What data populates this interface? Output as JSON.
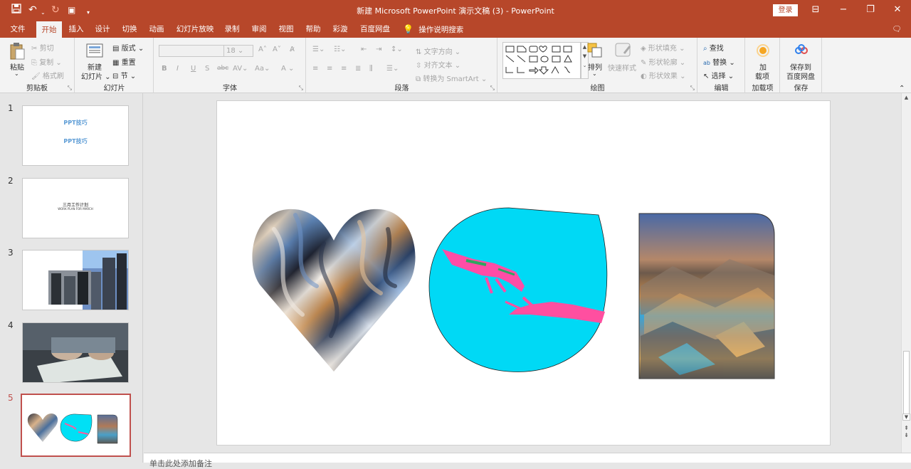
{
  "window": {
    "title": "新建 Microsoft PowerPoint 演示文稿 (3)  -  PowerPoint",
    "login_label": "登录"
  },
  "tabs": [
    "文件",
    "开始",
    "插入",
    "设计",
    "切换",
    "动画",
    "幻灯片放映",
    "录制",
    "审阅",
    "视图",
    "帮助",
    "彩漩",
    "百度网盘"
  ],
  "active_tab": "开始",
  "tell_me": "操作说明搜索",
  "ribbon": {
    "clipboard": {
      "label": "剪贴板",
      "paste": "粘贴",
      "cut": "剪切",
      "copy": "复制",
      "format_painter": "格式刷"
    },
    "slides": {
      "label": "幻灯片",
      "new_slide_line1": "新建",
      "new_slide_line2": "幻灯片",
      "layout": "版式",
      "reset": "重置",
      "section": "节"
    },
    "font": {
      "label": "字体",
      "size": "18"
    },
    "paragraph": {
      "label": "段落",
      "text_direction": "文字方向",
      "align_text": "对齐文本",
      "smartart": "转换为 SmartArt"
    },
    "drawing": {
      "label": "绘图",
      "arrange": "排列",
      "quick_styles": "快速样式",
      "shape_fill": "形状填充",
      "shape_outline": "形状轮廓",
      "shape_effects": "形状效果"
    },
    "editing": {
      "label": "编辑",
      "find": "查找",
      "replace": "替换",
      "select": "选择"
    },
    "addins": {
      "label": "加载项",
      "btn_line1": "加",
      "btn_line2": "载项"
    },
    "save": {
      "label": "保存",
      "btn_line1": "保存到",
      "btn_line2": "百度网盘"
    }
  },
  "slides": [
    {
      "num": "1",
      "text1": "PPT技巧",
      "text2": "PPT技巧"
    },
    {
      "num": "2",
      "text1": "三月工作计划",
      "text2": "WORK PLAN FOR MARCH"
    },
    {
      "num": "3"
    },
    {
      "num": "4"
    },
    {
      "num": "5"
    }
  ],
  "notes_placeholder": "单击此处添加备注",
  "colors": {
    "accent": "#b7472a",
    "selection": "#c0504d",
    "cyan": "#00d4ef"
  }
}
